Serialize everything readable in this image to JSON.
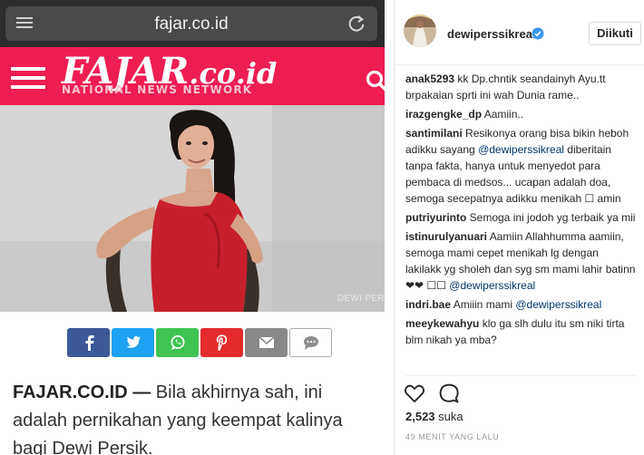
{
  "browser": {
    "url": "fajar.co.id",
    "menu_icon": "menu-icon",
    "reload_icon": "reload-icon"
  },
  "site": {
    "logo_main": "FAJAR",
    "logo_suffix": ".co.id",
    "tagline": "NATIONAL NEWS NETWORK",
    "header_color": "#ee1d52"
  },
  "photo": {
    "credit": "DEWI PER"
  },
  "share_buttons": [
    {
      "name": "facebook",
      "icon": "facebook-icon",
      "color": "#3b5998"
    },
    {
      "name": "twitter",
      "icon": "twitter-icon",
      "color": "#1da1f2"
    },
    {
      "name": "whatsapp",
      "icon": "whatsapp-icon",
      "color": "#3fc451"
    },
    {
      "name": "pinterest",
      "icon": "pinterest-icon",
      "color": "#e32b2b"
    },
    {
      "name": "email",
      "icon": "email-icon",
      "color": "#888888"
    },
    {
      "name": "comment",
      "icon": "comment-icon",
      "color": "#ffffff"
    }
  ],
  "article": {
    "dateline": "FAJAR.CO.ID —",
    "text": " Bila akhirnya sah, ini adalah pernikahan yang keempat kalinya bagi Dewi Persik."
  },
  "instagram": {
    "username": "dewiperssikreal",
    "follow_label": "Diikuti",
    "comments": [
      {
        "user": "anak5293",
        "text": " kk Dp.chntik seandainyh Ayu.tt brpakaian sprti ini wah Dunia rame..",
        "mention": ""
      },
      {
        "user": "irazgengke_dp",
        "text": " Aamiin..",
        "mention": ""
      },
      {
        "user": "santimilani",
        "text": " Resikonya orang bisa bikin heboh adikku sayang ",
        "mention": "@dewiperssikreal",
        "text_after": " diberitain tanpa fakta, hanya untuk menyedot para pembaca di medsos... ucapan adalah doa, semoga secepatnya adikku menikah ☐ amin"
      },
      {
        "user": "putriyurinto",
        "text": " Semoga ini jodoh yg terbaik ya mii",
        "mention": ""
      },
      {
        "user": "istinurulyanuari",
        "text": " Aamiin Allahhumma aamiin, semoga mami cepet menikah lg dengan lakilakk yg sholeh dan syg sm mami lahir batinn ❤❤ ☐☐ ",
        "mention": "@dewiperssikreal"
      },
      {
        "user": "indri.bae",
        "text": " Amiiin mami ",
        "mention": "@dewiperssikreal"
      },
      {
        "user": "meeykewahyu",
        "text": " klo ga slh dulu itu sm niki tirta blm nikah ya mba?",
        "mention": ""
      }
    ],
    "likes_count": "2,523",
    "likes_label": " suka",
    "timestamp": "49 MENIT YANG LALU",
    "accent": "#003569"
  }
}
